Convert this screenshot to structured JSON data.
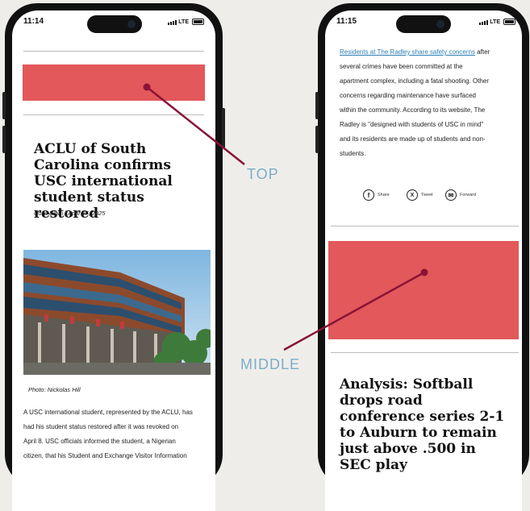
{
  "phone_left": {
    "time": "11:14",
    "network": "LTE",
    "headline": "ACLU of South Carolina confirms USC international student status restored",
    "byline": "Colin Elam | April 27, 2025",
    "photo_caption": "Photo: Nickolas Hill",
    "body_lines": [
      "A USC international student, represented by the ACLU, has",
      "had his student status restored after it was revoked on",
      "April 8. USC officials informed the student, a Nigerian",
      "citizen, that his Student and Exchange Visitor Information"
    ]
  },
  "phone_right": {
    "time": "11:15",
    "network": "LTE",
    "link_text": "Residents at The Radley share safety concerns",
    "body_first_rest": " after",
    "body_lines": [
      "several crimes have been committed at the",
      "apartment complex, including a fatal shooting. Other",
      "concerns regarding maintenance have surfaced",
      "within the community. According to its website, The",
      "Radley is \"designed with students of USC in mind\"",
      "and its residents are made up of students and non-",
      "students."
    ],
    "share_buttons": [
      {
        "label": "Share",
        "icon": "facebook-icon",
        "glyph": "f"
      },
      {
        "label": "Tweet",
        "icon": "x-icon",
        "glyph": "X"
      },
      {
        "label": "Forward",
        "icon": "mail-icon",
        "glyph": "✉"
      }
    ],
    "headline": "Analysis: Softball drops road conference series 2-1 to Auburn to remain just above .500 in SEC play"
  },
  "callouts": {
    "top": "TOP",
    "middle": "MIDDLE"
  },
  "colors": {
    "ad_placeholder": "#e2585b",
    "callout_line": "#8a1236",
    "callout_text": "#7aaec7",
    "link": "#2e7fb3"
  }
}
